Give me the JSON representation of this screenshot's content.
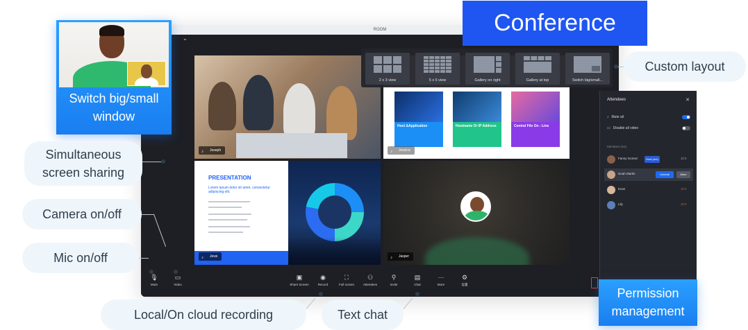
{
  "badge": {
    "title": "Conference"
  },
  "window": {
    "title": "ROOM"
  },
  "tiles": [
    {
      "name": "Joseph"
    },
    {
      "name": "Jessica",
      "cards": [
        {
          "heading": "Host &Application",
          "color": "#1b8ff5"
        },
        {
          "heading": "Hostname Or IP Address",
          "color": "#21c48a"
        },
        {
          "heading": "Central File On - Line",
          "color": "#8a3ae6"
        }
      ]
    },
    {
      "name": "Jessi",
      "presentation": {
        "heading": "PRESENTATION",
        "subheading": "Lorem ipsum dolor sit amet, consectetur adipiscing elit."
      }
    },
    {
      "name": "Jasper"
    }
  ],
  "layouts": [
    {
      "label": "2 x 3 view",
      "icon": "grid-2x3-icon"
    },
    {
      "label": "5 x 5 view",
      "icon": "grid-5x5-icon"
    },
    {
      "label": "Gallery on right",
      "icon": "gallery-right-icon"
    },
    {
      "label": "Gallery at top",
      "icon": "gallery-top-icon"
    },
    {
      "label": "Switch big/small...",
      "icon": "switch-big-small-icon"
    }
  ],
  "attendees": {
    "title": "Attendees",
    "mute_all": "Mute all",
    "disable_video": "Disable all video",
    "members_label": "Members (61)",
    "host_badge": "Host (me)",
    "unmute_label": "Unmute",
    "more_label": "More",
    "members": [
      {
        "name": "Fanny Gomez"
      },
      {
        "name": "Noah Martin"
      },
      {
        "name": "Evan"
      },
      {
        "name": "Lily"
      }
    ]
  },
  "controls": [
    {
      "label": "Mute",
      "icon": "mic-icon"
    },
    {
      "label": "Video",
      "icon": "video-icon"
    },
    {
      "label": "Share Screen",
      "icon": "share-screen-icon"
    },
    {
      "label": "Record",
      "icon": "record-icon"
    },
    {
      "label": "Full screen",
      "icon": "fullscreen-icon"
    },
    {
      "label": "Attendees",
      "icon": "attendees-icon"
    },
    {
      "label": "Invite",
      "icon": "invite-icon"
    },
    {
      "label": "Chat",
      "icon": "chat-icon"
    },
    {
      "label": "More",
      "icon": "more-icon"
    },
    {
      "label": "设置",
      "icon": "settings-icon"
    }
  ],
  "callouts": {
    "switch": "Switch big/small\nwindow",
    "simul": "Simultaneous\nscreen sharing",
    "camera": "Camera on/off",
    "mic": "Mic on/off",
    "recording": "Local/On cloud recording",
    "chat": "Text chat",
    "custom": "Custom layout",
    "permission": "Permission\nmanagement"
  },
  "colors": {
    "accent": "#1f56f2",
    "callout_bg": "#eef6fb",
    "callout_text": "#2f3d4b"
  }
}
